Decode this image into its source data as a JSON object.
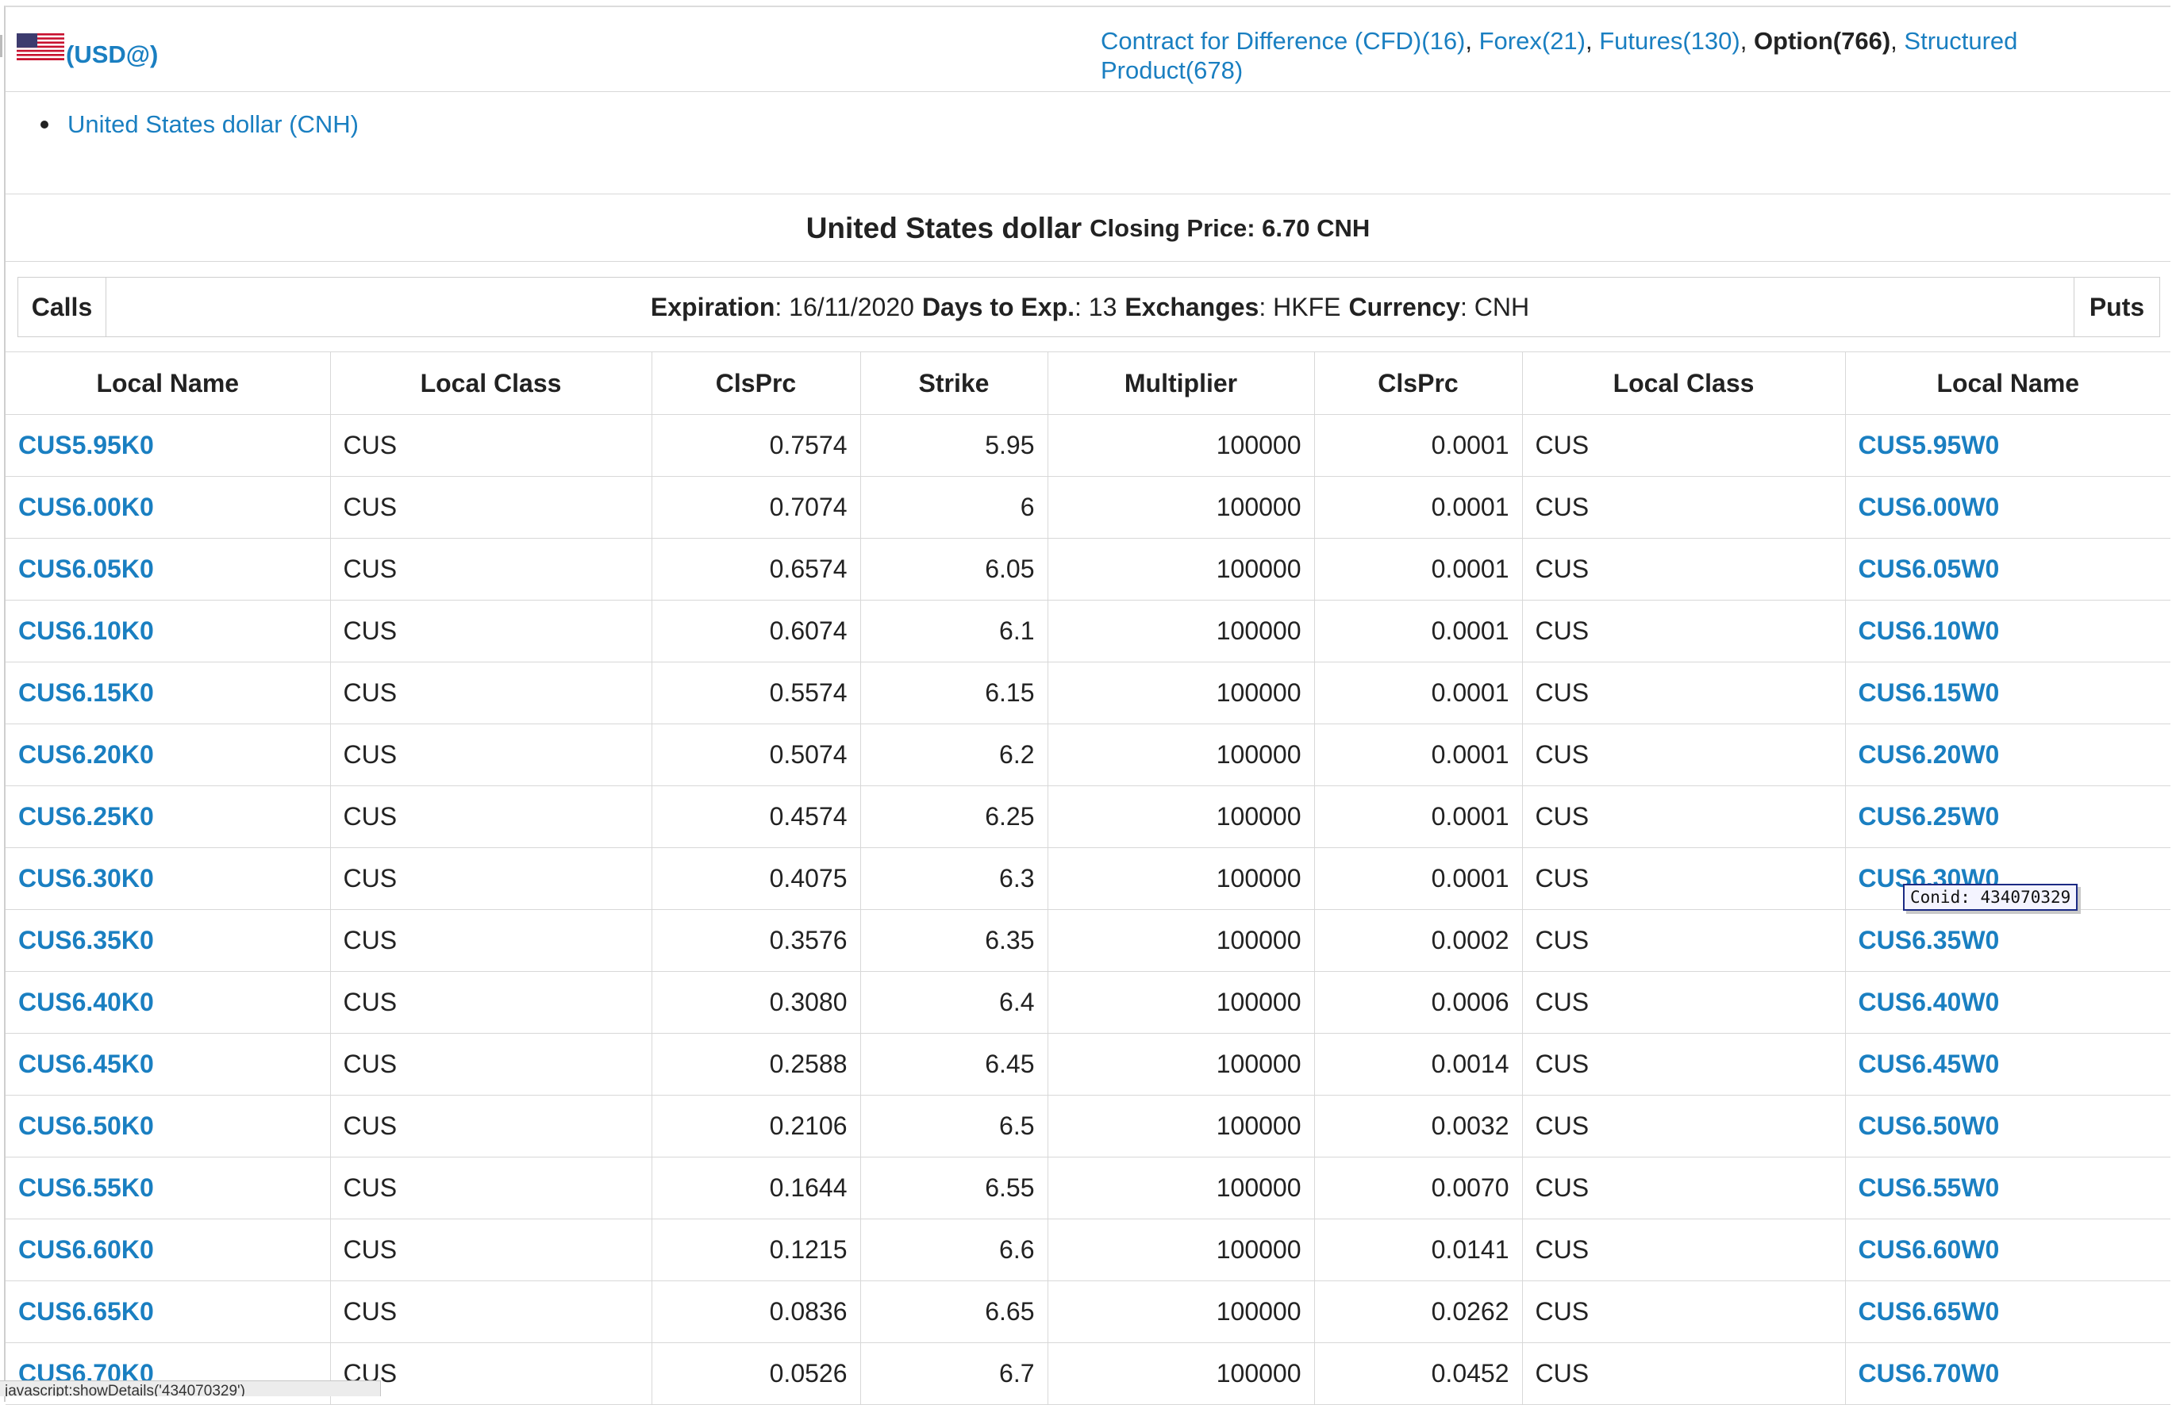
{
  "header": {
    "symbol": "(USD@)",
    "product_types": [
      {
        "label": "Contract for Difference (CFD)(16)",
        "current": false
      },
      {
        "label": "Forex(21)",
        "current": false
      },
      {
        "label": "Futures(130)",
        "current": false
      },
      {
        "label": "Option(766)",
        "current": true
      },
      {
        "label": "Structured Product(678)",
        "current": false
      }
    ]
  },
  "currency_list": [
    "United States dollar (CNH)"
  ],
  "underlying": {
    "name": "United States dollar",
    "closing_price": "Closing Price: 6.70 CNH"
  },
  "expiration_bar": {
    "calls": "Calls",
    "puts": "Puts",
    "expiration_label": "Expiration",
    "expiration_value": ": 16/11/2020",
    "days_label": "Days to Exp.",
    "days_value": ": 13",
    "exchanges_label": "Exchanges",
    "exchanges_value": ": HKFE",
    "currency_label": "Currency",
    "currency_value": ": CNH"
  },
  "table": {
    "columns": [
      "Local Name",
      "Local Class",
      "ClsPrc",
      "Strike",
      "Multiplier",
      "ClsPrc",
      "Local Class",
      "Local Name"
    ],
    "rows": [
      {
        "call": "CUS5.95K0",
        "call_class": "CUS",
        "call_price": "0.7574",
        "strike": "5.95",
        "multiplier": "100000",
        "put_price": "0.0001",
        "put_class": "CUS",
        "put": "CUS5.95W0"
      },
      {
        "call": "CUS6.00K0",
        "call_class": "CUS",
        "call_price": "0.7074",
        "strike": "6",
        "multiplier": "100000",
        "put_price": "0.0001",
        "put_class": "CUS",
        "put": "CUS6.00W0"
      },
      {
        "call": "CUS6.05K0",
        "call_class": "CUS",
        "call_price": "0.6574",
        "strike": "6.05",
        "multiplier": "100000",
        "put_price": "0.0001",
        "put_class": "CUS",
        "put": "CUS6.05W0"
      },
      {
        "call": "CUS6.10K0",
        "call_class": "CUS",
        "call_price": "0.6074",
        "strike": "6.1",
        "multiplier": "100000",
        "put_price": "0.0001",
        "put_class": "CUS",
        "put": "CUS6.10W0"
      },
      {
        "call": "CUS6.15K0",
        "call_class": "CUS",
        "call_price": "0.5574",
        "strike": "6.15",
        "multiplier": "100000",
        "put_price": "0.0001",
        "put_class": "CUS",
        "put": "CUS6.15W0"
      },
      {
        "call": "CUS6.20K0",
        "call_class": "CUS",
        "call_price": "0.5074",
        "strike": "6.2",
        "multiplier": "100000",
        "put_price": "0.0001",
        "put_class": "CUS",
        "put": "CUS6.20W0"
      },
      {
        "call": "CUS6.25K0",
        "call_class": "CUS",
        "call_price": "0.4574",
        "strike": "6.25",
        "multiplier": "100000",
        "put_price": "0.0001",
        "put_class": "CUS",
        "put": "CUS6.25W0"
      },
      {
        "call": "CUS6.30K0",
        "call_class": "CUS",
        "call_price": "0.4075",
        "strike": "6.3",
        "multiplier": "100000",
        "put_price": "0.0001",
        "put_class": "CUS",
        "put": "CUS6.30W0"
      },
      {
        "call": "CUS6.35K0",
        "call_class": "CUS",
        "call_price": "0.3576",
        "strike": "6.35",
        "multiplier": "100000",
        "put_price": "0.0002",
        "put_class": "CUS",
        "put": "CUS6.35W0"
      },
      {
        "call": "CUS6.40K0",
        "call_class": "CUS",
        "call_price": "0.3080",
        "strike": "6.4",
        "multiplier": "100000",
        "put_price": "0.0006",
        "put_class": "CUS",
        "put": "CUS6.40W0"
      },
      {
        "call": "CUS6.45K0",
        "call_class": "CUS",
        "call_price": "0.2588",
        "strike": "6.45",
        "multiplier": "100000",
        "put_price": "0.0014",
        "put_class": "CUS",
        "put": "CUS6.45W0"
      },
      {
        "call": "CUS6.50K0",
        "call_class": "CUS",
        "call_price": "0.2106",
        "strike": "6.5",
        "multiplier": "100000",
        "put_price": "0.0032",
        "put_class": "CUS",
        "put": "CUS6.50W0"
      },
      {
        "call": "CUS6.55K0",
        "call_class": "CUS",
        "call_price": "0.1644",
        "strike": "6.55",
        "multiplier": "100000",
        "put_price": "0.0070",
        "put_class": "CUS",
        "put": "CUS6.55W0"
      },
      {
        "call": "CUS6.60K0",
        "call_class": "CUS",
        "call_price": "0.1215",
        "strike": "6.6",
        "multiplier": "100000",
        "put_price": "0.0141",
        "put_class": "CUS",
        "put": "CUS6.60W0"
      },
      {
        "call": "CUS6.65K0",
        "call_class": "CUS",
        "call_price": "0.0836",
        "strike": "6.65",
        "multiplier": "100000",
        "put_price": "0.0262",
        "put_class": "CUS",
        "put": "CUS6.65W0"
      },
      {
        "call": "CUS6.70K0",
        "call_class": "CUS",
        "call_price": "0.0526",
        "strike": "6.7",
        "multiplier": "100000",
        "put_price": "0.0452",
        "put_class": "CUS",
        "put": "CUS6.70W0"
      }
    ]
  },
  "tooltip": "Conid: 434070329",
  "status_bar": "javascript:showDetails('434070329')",
  "colors": {
    "link": "#1a7fc1",
    "border": "#d8d8d8",
    "tooltip_border": "#1b2a84"
  }
}
